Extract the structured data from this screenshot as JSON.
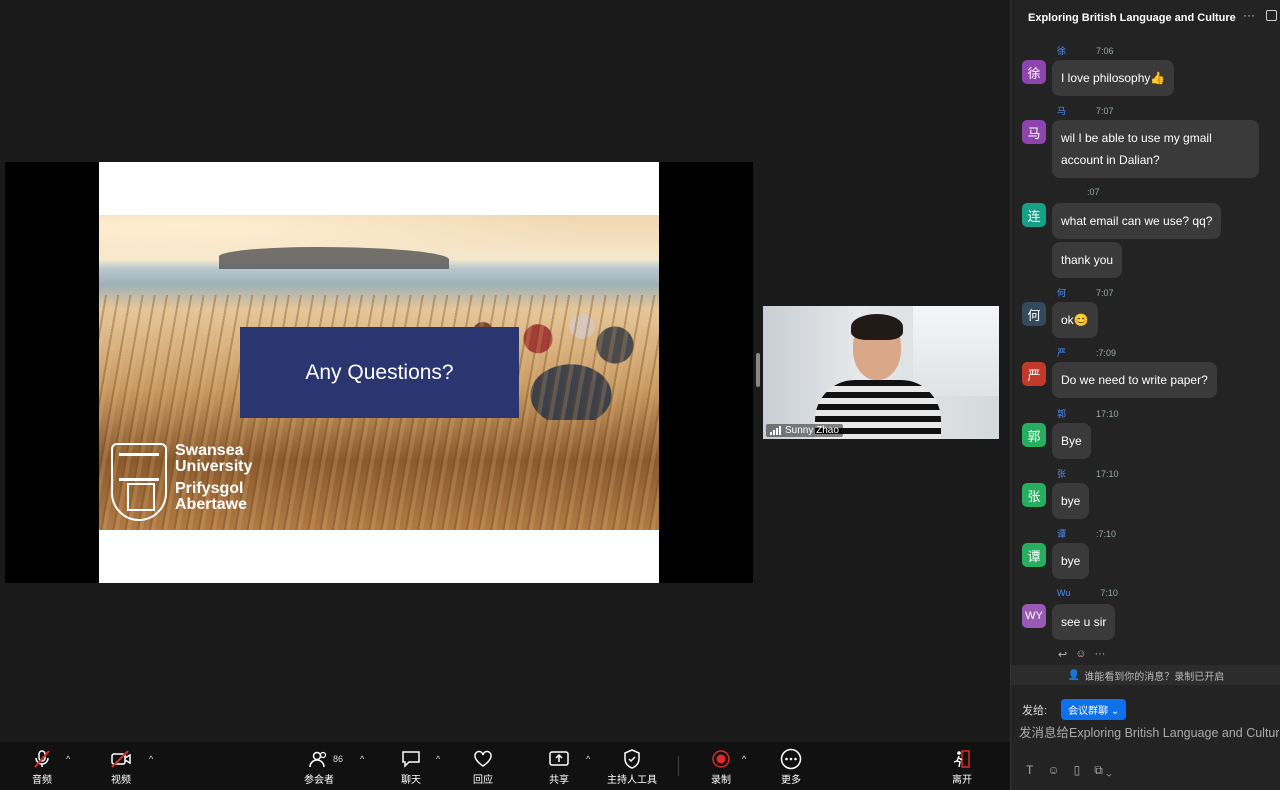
{
  "slide": {
    "question": "Any Questions?",
    "logo_lines": [
      "Swansea",
      "University",
      "Prifysgol",
      "Abertawe"
    ]
  },
  "video": {
    "participant_name": "Sunny Zhao"
  },
  "chat": {
    "title": "Exploring British Language and Culture",
    "messages": [
      {
        "avatar": "徐",
        "avatar_color": "#8e44ad",
        "sender": "徐",
        "time": "7:06",
        "text": [
          "I love philosophy👍"
        ]
      },
      {
        "avatar": "马",
        "avatar_color": "#8e44ad",
        "sender": "马",
        "time": "7:07",
        "text": [
          "wil I be able to use my gmail account in Dalian?"
        ]
      },
      {
        "avatar": "连",
        "avatar_color": "#16a085",
        "sender": "",
        "time": ":07",
        "text": [
          "what email can we use?  qq?",
          "thank you"
        ]
      },
      {
        "avatar": "何",
        "avatar_color": "#34495e",
        "sender": "何",
        "time": "7:07",
        "text": [
          "ok😊"
        ]
      },
      {
        "avatar": "严",
        "avatar_color": "#c0392b",
        "sender": "严",
        "time": ":7:09",
        "text": [
          "Do we need to write paper?"
        ]
      },
      {
        "avatar": "郭",
        "avatar_color": "#27ae60",
        "sender": "郭",
        "time": "17:10",
        "text": [
          "Bye"
        ]
      },
      {
        "avatar": "张",
        "avatar_color": "#27ae60",
        "sender": "张",
        "time": "17:10",
        "text": [
          "bye"
        ]
      },
      {
        "avatar": "谭",
        "avatar_color": "#27ae60",
        "sender": "谭",
        "time": ":7:10",
        "text": [
          "bye"
        ]
      },
      {
        "avatar": "WY",
        "avatar_color": "#9b59b6",
        "sender": "Wu",
        "time": "7:10",
        "text": [
          "see u sir"
        ]
      }
    ],
    "notice": "谁能看到你的消息？录制已开启",
    "send_to_label": "发给:",
    "send_to_target": "会议群聊",
    "compose_placeholder": "发消息给Exploring British Language and Culture"
  },
  "toolbar": {
    "audio": "音频",
    "video": "视频",
    "participants": "参会者",
    "participants_count": "86",
    "chat": "聊天",
    "react": "回应",
    "share": "共享",
    "host_tools": "主持人工具",
    "record": "录制",
    "more": "更多",
    "leave": "离开"
  },
  "colors": {
    "accent": "#0e71eb",
    "record": "#e02828",
    "leave": "#e02828",
    "slide_box": "#2b3570"
  }
}
